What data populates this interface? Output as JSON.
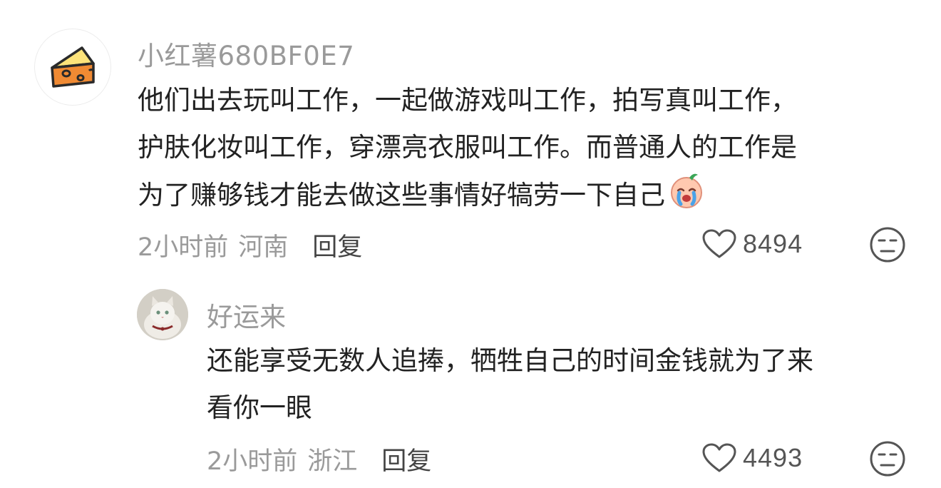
{
  "comments": [
    {
      "avatar_icon": "cheese-icon",
      "username": "小红薯680BF0E7",
      "content_lines": [
        "他们出去玩叫工作，一起做游戏叫工作，拍写真叫工作，",
        "护肤化妆叫工作，穿漂亮衣服叫工作。而普通人的工作是",
        "为了赚够钱才能去做这些事情好犒劳一下自己"
      ],
      "trailing_emoji": "crying-face-emoji",
      "time": "2小时前",
      "location": "河南",
      "reply_label": "回复",
      "like_count": "8494"
    },
    {
      "avatar_icon": "cat-avatar",
      "username": "好运来",
      "content_lines": [
        "还能享受无数人追捧，牺牲自己的时间金钱就为了来",
        "看你一眼"
      ],
      "time": "2小时前",
      "location": "浙江",
      "reply_label": "回复",
      "like_count": "4493"
    }
  ],
  "colors": {
    "muted_text": "#9a9a9a",
    "body_text": "#222222",
    "icon_stroke": "#555555",
    "cheese": "#f7b733",
    "cheese_shadow": "#e8772e"
  }
}
